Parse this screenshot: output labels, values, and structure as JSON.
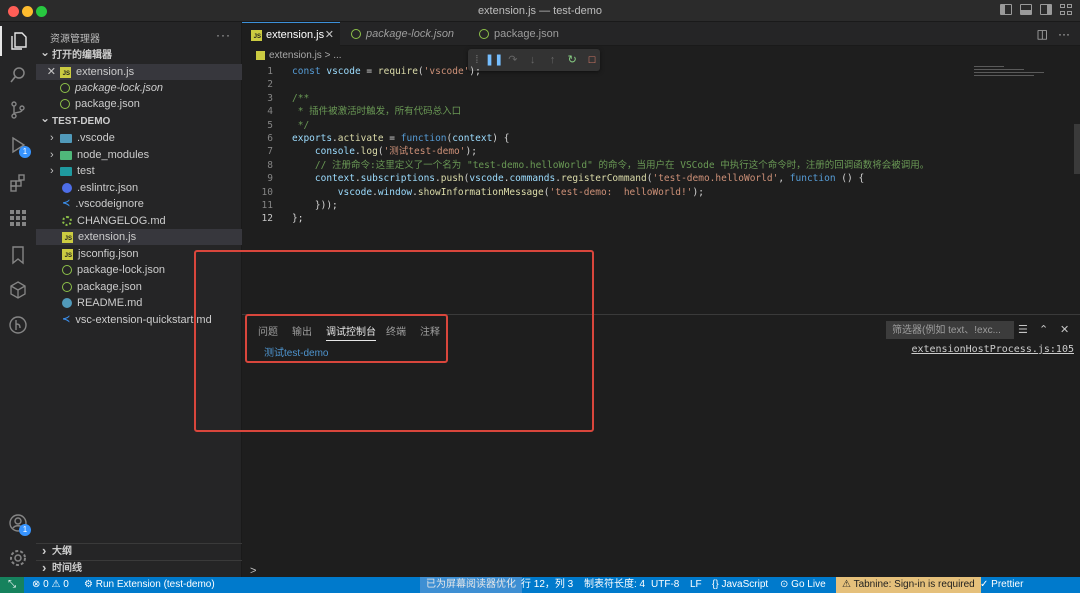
{
  "window": {
    "title": "extension.js — test-demo"
  },
  "sidebar": {
    "title": "资源管理器",
    "open_editors_header": "打开的编辑器",
    "open_editors": [
      {
        "name": "extension.js",
        "icon": "js-icon",
        "italic": false
      },
      {
        "name": "package-lock.json",
        "icon": "json-icon",
        "italic": true
      },
      {
        "name": "package.json",
        "icon": "json-icon",
        "italic": false
      }
    ],
    "project_header": "TEST-DEMO",
    "files": [
      {
        "name": ".vscode",
        "icon": "folder-icon",
        "chevron": "›"
      },
      {
        "name": "node_modules",
        "icon": "folder-icon",
        "chevron": "›"
      },
      {
        "name": "test",
        "icon": "folder-icon",
        "chevron": "›"
      },
      {
        "name": ".eslintrc.json",
        "icon": "eslint-icon"
      },
      {
        "name": ".vscodeignore",
        "icon": "vscode-icon"
      },
      {
        "name": "CHANGELOG.md",
        "icon": "changelog-icon"
      },
      {
        "name": "extension.js",
        "icon": "js-icon",
        "selected": true
      },
      {
        "name": "jsconfig.json",
        "icon": "js-icon"
      },
      {
        "name": "package-lock.json",
        "icon": "json-icon"
      },
      {
        "name": "package.json",
        "icon": "json-icon"
      },
      {
        "name": "README.md",
        "icon": "info-icon"
      },
      {
        "name": "vsc-extension-quickstart.md",
        "icon": "vscode-icon"
      }
    ],
    "outline_header": "大纲",
    "timeline_header": "时间线"
  },
  "tabs": [
    {
      "label": "extension.js",
      "active": true
    },
    {
      "label": "package-lock.json",
      "active": false
    },
    {
      "label": "package.json",
      "active": false
    }
  ],
  "breadcrumb": "extension.js > ...",
  "editor": {
    "current_line": 12,
    "lines": [
      "const vscode = require('vscode');",
      "",
      "/**",
      " * 插件被激活时触发，所有代码总入口",
      " */",
      "exports.activate = function(context) {",
      "    console.log('测试test-demo');",
      "    // 注册命令:这里定义了一个名为 \"test-demo.helloWorld\" 的命令，当用户在 VSCode 中执行这个命令时，注册的回调函数将会被调用。",
      "    context.subscriptions.push(vscode.commands.registerCommand('test-demo.helloWorld', function () {",
      "        vscode.window.showInformationMessage('test-demo:  helloWorld!');",
      "    }));",
      "};"
    ]
  },
  "panel": {
    "tabs": [
      {
        "label": "问题",
        "active": false
      },
      {
        "label": "输出",
        "active": false
      },
      {
        "label": "调试控制台",
        "active": true
      },
      {
        "label": "终端",
        "active": false
      },
      {
        "label": "注释",
        "active": false
      }
    ],
    "filter_placeholder": "筛选器(例如 text、!exc...",
    "console_output": "测试test-demo",
    "console_source": "extensionHostProcess.js:105",
    "prompt": ">"
  },
  "status": {
    "errors": "0",
    "warnings": "0",
    "run": "Run Extension (test-demo)",
    "screen_reader": "已为屏幕阅读器优化",
    "position": "行 12，列 3",
    "tab_size": "制表符长度: 4",
    "encoding": "UTF-8",
    "eol": "LF",
    "language": "JavaScript",
    "golive": "Go Live",
    "tabnine": "Tabnine: Sign-in is required",
    "prettier": "Prettier"
  },
  "colors": {
    "accent": "#007acc",
    "highlight_box": "#d9463c"
  }
}
